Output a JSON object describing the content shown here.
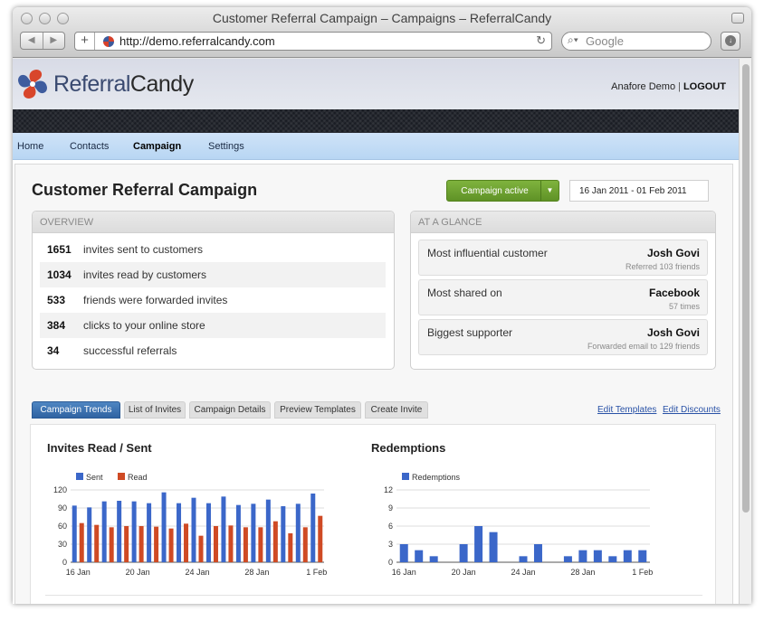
{
  "window": {
    "title": "Customer Referral Campaign – Campaigns – ReferralCandy",
    "url": "http://demo.referralcandy.com",
    "search_placeholder": "Google"
  },
  "header": {
    "logo_text_part1": "Referral",
    "logo_text_part2": "Candy",
    "user_name": "Anafore Demo",
    "user_separator": "|",
    "logout_label": "LOGOUT"
  },
  "nav": {
    "items": [
      {
        "label": "Home"
      },
      {
        "label": "Contacts"
      },
      {
        "label": "Campaign"
      },
      {
        "label": "Settings"
      }
    ]
  },
  "campaign": {
    "title": "Customer Referral Campaign",
    "status_label": "Campaign active",
    "date_range": "16 Jan 2011   - 01 Feb 2011"
  },
  "overview": {
    "heading": "Overview",
    "rows": [
      {
        "num": "1651",
        "text": "invites sent to customers"
      },
      {
        "num": "1034",
        "text": "invites read by customers"
      },
      {
        "num": "533",
        "text": "friends were forwarded invites"
      },
      {
        "num": "384",
        "text": "clicks to your online store"
      },
      {
        "num": "34",
        "text": "successful referrals"
      }
    ]
  },
  "glance": {
    "heading": "At a Glance",
    "cards": [
      {
        "label": "Most influential customer",
        "value": "Josh Govi",
        "sub": "Referred 103 friends"
      },
      {
        "label": "Most shared on",
        "value": "Facebook",
        "sub": "57 times"
      },
      {
        "label": "Biggest supporter",
        "value": "Josh Govi",
        "sub": "Forwarded email to 129 friends"
      }
    ]
  },
  "tabs": [
    {
      "label": "Campaign Trends"
    },
    {
      "label": "List of Invites"
    },
    {
      "label": "Campaign Details"
    },
    {
      "label": "Preview Templates"
    },
    {
      "label": "Create Invite"
    }
  ],
  "links": {
    "edit_templates": "Edit Templates",
    "edit_discounts": "Edit Discounts"
  },
  "colors": {
    "sent": "#3b67c9",
    "read": "#cf4a24",
    "redemptions": "#3b67c9"
  },
  "chart_data": [
    {
      "type": "bar",
      "title": "Invites Read / Sent",
      "xlabel": "",
      "ylabel": "",
      "ylim": [
        0,
        120
      ],
      "yticks": [
        0,
        30,
        60,
        90,
        120
      ],
      "x_tick_labels": [
        {
          "index": 0,
          "label": "16 Jan"
        },
        {
          "index": 4,
          "label": "20 Jan"
        },
        {
          "index": 8,
          "label": "24 Jan"
        },
        {
          "index": 12,
          "label": "28 Jan"
        },
        {
          "index": 16,
          "label": "1 Feb"
        }
      ],
      "legend_position": "top-left",
      "grid": true,
      "series": [
        {
          "name": "Sent",
          "color": "#3b67c9",
          "values": [
            94,
            91,
            101,
            102,
            101,
            98,
            116,
            98,
            107,
            98,
            109,
            95,
            97,
            104,
            93,
            97,
            114
          ]
        },
        {
          "name": "Read",
          "color": "#cf4a24",
          "values": [
            65,
            62,
            58,
            60,
            60,
            59,
            56,
            64,
            44,
            60,
            61,
            58,
            58,
            68,
            48,
            58,
            77
          ]
        }
      ]
    },
    {
      "type": "bar",
      "title": "Redemptions",
      "xlabel": "",
      "ylabel": "",
      "ylim": [
        0,
        12
      ],
      "yticks": [
        0,
        3,
        6,
        9,
        12
      ],
      "x_tick_labels": [
        {
          "index": 0,
          "label": "16 Jan"
        },
        {
          "index": 4,
          "label": "20 Jan"
        },
        {
          "index": 8,
          "label": "24 Jan"
        },
        {
          "index": 12,
          "label": "28 Jan"
        },
        {
          "index": 16,
          "label": "1 Feb"
        }
      ],
      "legend_position": "top-left",
      "grid": true,
      "series": [
        {
          "name": "Redemptions",
          "color": "#3b67c9",
          "values": [
            3,
            2,
            1,
            0,
            3,
            6,
            5,
            0,
            1,
            3,
            0,
            1,
            2,
            2,
            1,
            2,
            2
          ]
        }
      ]
    }
  ]
}
